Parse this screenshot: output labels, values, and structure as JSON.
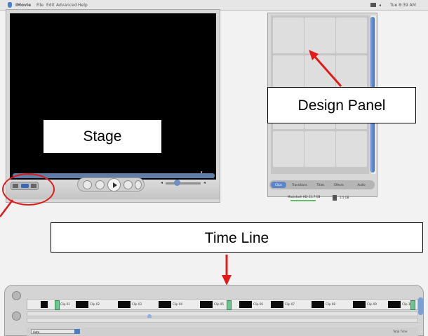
{
  "menubar": {
    "app_name": "iMovie",
    "items": [
      "File",
      "Edit",
      "Advanced",
      "Help"
    ],
    "clock": "Tue 8:39 AM"
  },
  "stage": {
    "caption": "Stage"
  },
  "design_panel": {
    "caption": "Design Panel",
    "tabs": [
      "Clips",
      "Transitions",
      "Titles",
      "Effects",
      "Audio"
    ],
    "status": "Macintosh HD: 11.7 GB",
    "size": "1.5 GB"
  },
  "timeline": {
    "caption": "Time Line",
    "clip_labels": [
      "Clip 01",
      "Clip 02",
      "Clip 03",
      "Clip 04",
      "Clip 05",
      "Clip 06",
      "Clip 07",
      "Clip 08",
      "Clip 09",
      "Clip 10"
    ],
    "zoom_label": "Auto",
    "bottom_right": "Total Time"
  },
  "annotations": {
    "arrow_color": "#e21a1a"
  }
}
